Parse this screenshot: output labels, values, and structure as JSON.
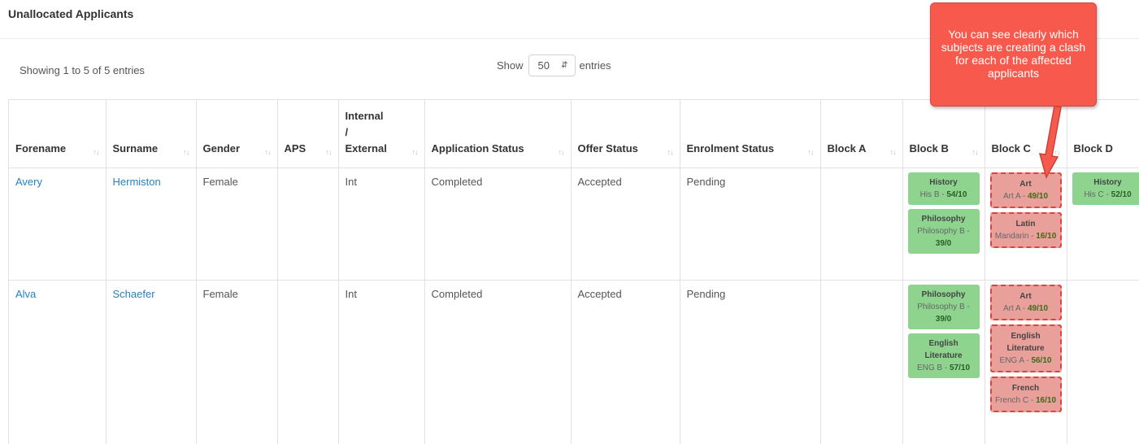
{
  "page": {
    "title": "Unallocated Applicants"
  },
  "table_info": {
    "showing": "Showing 1 to 5 of 5 entries",
    "show_label": "Show",
    "page_size": "50",
    "entries_label": "entries"
  },
  "columns": [
    "Forename",
    "Surname",
    "Gender",
    "APS",
    "Internal / External",
    "Application Status",
    "Offer Status",
    "Enrolment Status",
    "Block A",
    "Block B",
    "Block C",
    "Block D"
  ],
  "column_internal_lines": [
    "Internal",
    "/",
    "External"
  ],
  "rows": [
    {
      "forename": "Avery",
      "surname": "Hermiston",
      "gender": "Female",
      "aps": "",
      "int_ext": "Int",
      "application_status": "Completed",
      "offer_status": "Accepted",
      "enrolment_status": "Pending",
      "block_b": [
        {
          "subject": "History",
          "detail": "His B - ",
          "score": "54/10"
        },
        {
          "subject": "Philosophy",
          "detail": "Philosophy B - ",
          "score": "39/0"
        }
      ],
      "block_c": [
        {
          "subject": "Art",
          "detail": "Art A - ",
          "score": "49/10"
        },
        {
          "subject": "Latin",
          "detail": "Mandarin - ",
          "score": "16/10"
        }
      ],
      "block_d": [
        {
          "subject": "History",
          "detail": "His C - ",
          "score": "52/10"
        }
      ]
    },
    {
      "forename": "Alva",
      "surname": "Schaefer",
      "gender": "Female",
      "aps": "",
      "int_ext": "Int",
      "application_status": "Completed",
      "offer_status": "Accepted",
      "enrolment_status": "Pending",
      "block_b": [
        {
          "subject": "Philosophy",
          "detail": "Philosophy B - ",
          "score": "39/0"
        },
        {
          "subject": "English Literature",
          "detail": "ENG B - ",
          "score": "57/10"
        }
      ],
      "block_c": [
        {
          "subject": "Art",
          "detail": "Art A - ",
          "score": "49/10"
        },
        {
          "subject": "English Literature",
          "detail": "ENG A - ",
          "score": "56/10"
        },
        {
          "subject": "French",
          "detail": "French C - ",
          "score": "16/10"
        }
      ],
      "block_d": []
    }
  ],
  "callout": {
    "text": "You can see clearly which subjects are creating a clash for each of the affected applicants"
  },
  "colors": {
    "link": "#2a7fc1",
    "ok_card": "#8ed48e",
    "clash_card": "#e9a09b",
    "clash_border": "#e04040",
    "callout": "#f75a4c"
  },
  "icons": {
    "sort": "sort-icon",
    "select": "select-arrows-icon",
    "arrow": "callout-arrow-icon"
  }
}
